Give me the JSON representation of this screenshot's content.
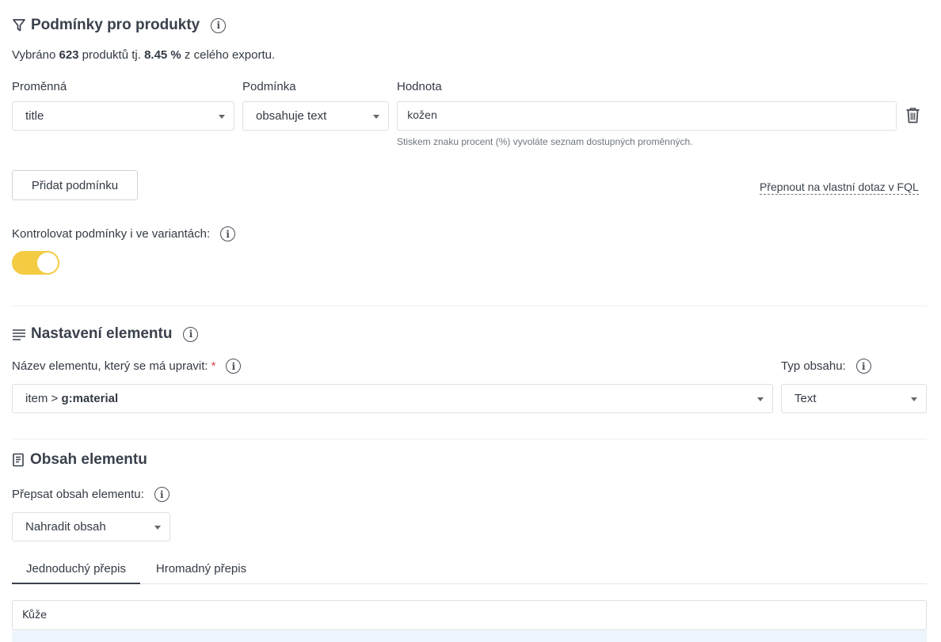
{
  "conditions": {
    "title": "Podmínky pro produkty",
    "summary": {
      "prefix": "Vybráno ",
      "count": "623",
      "middle": " produktů tj. ",
      "percent": "8.45 %",
      "suffix": " z celého exportu."
    },
    "headers": {
      "variable": "Proměnná",
      "condition": "Podmínka",
      "value": "Hodnota"
    },
    "row": {
      "variable": "title",
      "condition": "obsahuje text",
      "value": "kožen"
    },
    "hint": "Stiskem znaku procent (%) vyvoláte seznam dostupných proměnných.",
    "add_button": "Přidat podmínku",
    "fql_link": "Přepnout na vlastní dotaz v FQL",
    "variants_label": "Kontrolovat podmínky i ve variantách:",
    "variants_toggle_on": true
  },
  "element_settings": {
    "title": "Nastavení elementu",
    "name_label": "Název elementu, který se má upravit:",
    "required_mark": "*",
    "element_prefix": "item > ",
    "element_name": "g:material",
    "type_label": "Typ obsahu:",
    "type_value": "Text"
  },
  "element_content": {
    "title": "Obsah elementu",
    "overwrite_label": "Přepsat obsah elementu:",
    "overwrite_value": "Nahradit obsah",
    "tabs": [
      {
        "label": "Jednoduchý přepis",
        "active": true
      },
      {
        "label": "Hromadný přepis",
        "active": false
      }
    ],
    "content_value": "Kůže"
  },
  "colors": {
    "accent": "#f3cc44",
    "required": "#e0474c",
    "border": "#dcdfe4"
  }
}
